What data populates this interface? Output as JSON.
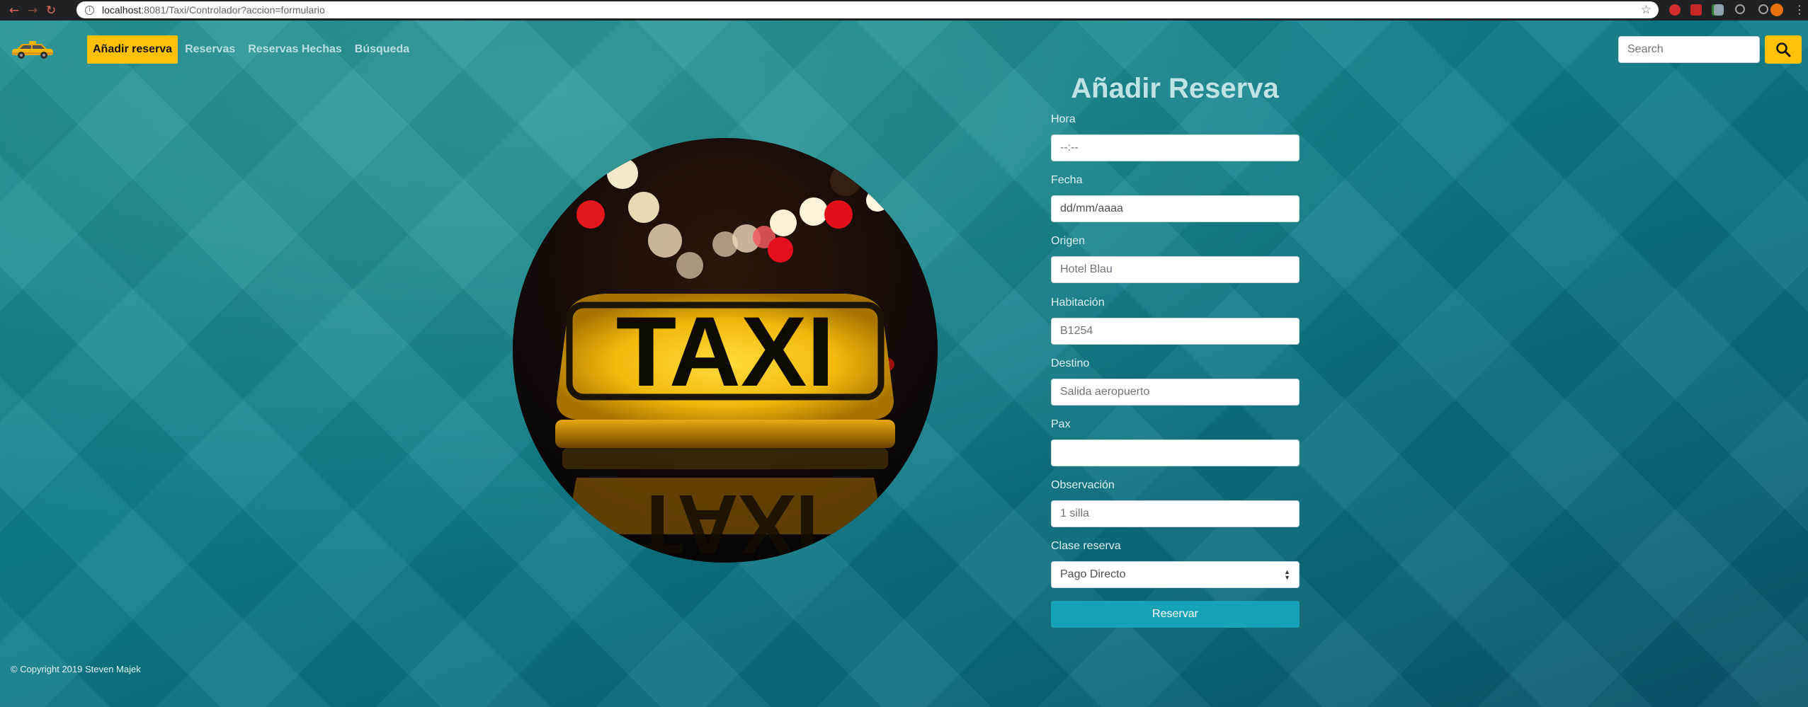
{
  "browser": {
    "url_host": "localhost",
    "url_path": ":8081/Taxi/Controlador?accion=formulario",
    "back_icon": "arrow-left-icon",
    "forward_icon": "arrow-right-icon",
    "reload_icon": "reload-icon"
  },
  "navbar": {
    "logo": "taxi-car-logo",
    "items": [
      {
        "label": "Añadir reserva",
        "active": true
      },
      {
        "label": "Reservas"
      },
      {
        "label": "Reservas Hechas"
      },
      {
        "label": "Búsqueda"
      }
    ],
    "search_placeholder": "Search",
    "search_icon": "search-icon",
    "accent": "#ffc107"
  },
  "hero": {
    "sign_text": "TAXI"
  },
  "form": {
    "title": "Añadir Reserva",
    "fields": [
      {
        "label": "Hora",
        "value": "--:--"
      },
      {
        "label": "Fecha",
        "value": "dd/mm/aaaa"
      },
      {
        "label": "Origen",
        "value": "Hotel Blau"
      },
      {
        "label": "Habitación",
        "value": "B1254"
      },
      {
        "label": "Destino",
        "value": "Salida aeropuerto"
      },
      {
        "label": "Pax",
        "value": ""
      },
      {
        "label": "Observación",
        "value": "1 silla"
      },
      {
        "label": "Clase reserva",
        "value": "Pago Directo"
      }
    ],
    "submit_label": "Reservar",
    "submit_color": "#17a2b8"
  },
  "footer": {
    "text": "© Copyright 2019 Steven Majek"
  }
}
